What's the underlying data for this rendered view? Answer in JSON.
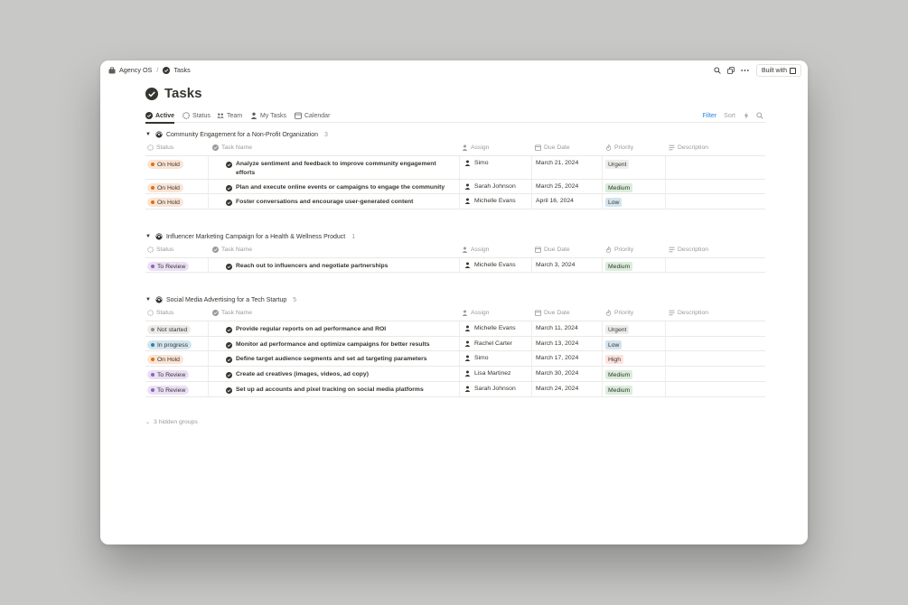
{
  "breadcrumb": {
    "workspace": "Agency OS",
    "separator": "/",
    "page": "Tasks"
  },
  "top_actions": {
    "built_label": "Built with"
  },
  "page": {
    "title": "Tasks"
  },
  "tabs": [
    {
      "label": "Active",
      "icon": "check-circle-icon",
      "active": true
    },
    {
      "label": "Status",
      "icon": "circle-icon",
      "active": false
    },
    {
      "label": "Team",
      "icon": "people-icon",
      "active": false
    },
    {
      "label": "My Tasks",
      "icon": "person-icon",
      "active": false
    },
    {
      "label": "Calendar",
      "icon": "calendar-icon",
      "active": false
    }
  ],
  "toolbar": {
    "filter": "Filter",
    "sort": "Sort"
  },
  "columns": {
    "status": "Status",
    "task": "Task Name",
    "assign": "Assign",
    "due": "Due Date",
    "priority": "Priority",
    "description": "Description"
  },
  "colors": {
    "onhold_bg": "#fbe4d5",
    "onhold_dot": "#d9730d",
    "review_bg": "#ebdff5",
    "review_dot": "#9065b0",
    "notstarted_bg": "#ecebea",
    "notstarted_dot": "#91918e",
    "inprogress_bg": "#d3e5ef",
    "inprogress_dot": "#337ea9",
    "urgent_bg": "#ededeb",
    "medium_bg": "#dbeddb",
    "low_bg": "#d3e5ef",
    "high_bg": "#ffe2dd",
    "filter": "#2383e2"
  },
  "groups": [
    {
      "name": "Community Engagement for a Non-Profit Organization",
      "count": "3",
      "rows": [
        {
          "status": "On Hold",
          "status_kind": "onhold",
          "task": "Analyze sentiment and feedback to improve community engagement efforts",
          "assign": "Simo",
          "due": "March 21, 2024",
          "priority": "Urgent",
          "priority_kind": "urgent"
        },
        {
          "status": "On Hold",
          "status_kind": "onhold",
          "task": "Plan and execute online events or campaigns to engage the community",
          "assign": "Sarah Johnson",
          "due": "March 25, 2024",
          "priority": "Medium",
          "priority_kind": "medium"
        },
        {
          "status": "On Hold",
          "status_kind": "onhold",
          "task": "Foster conversations and encourage user-generated content",
          "assign": "Michelle Evans",
          "due": "April 16, 2024",
          "priority": "Low",
          "priority_kind": "low"
        }
      ]
    },
    {
      "name": "Influencer Marketing Campaign for a Health & Wellness Product",
      "count": "1",
      "rows": [
        {
          "status": "To Review",
          "status_kind": "review",
          "task": "Reach out to influencers and negotiate partnerships",
          "assign": "Michelle Evans",
          "due": "March 3, 2024",
          "priority": "Medium",
          "priority_kind": "medium"
        }
      ]
    },
    {
      "name": "Social Media Advertising for a Tech Startup",
      "count": "5",
      "rows": [
        {
          "status": "Not started",
          "status_kind": "notstarted",
          "task": "Provide regular reports on ad performance and ROI",
          "assign": "Michelle Evans",
          "due": "March 11, 2024",
          "priority": "Urgent",
          "priority_kind": "urgent"
        },
        {
          "status": "In progress",
          "status_kind": "inprogress",
          "task": "Monitor ad performance and optimize campaigns for better results",
          "assign": "Rachel Carter",
          "due": "March 13, 2024",
          "priority": "Low",
          "priority_kind": "low"
        },
        {
          "status": "On Hold",
          "status_kind": "onhold",
          "task": "Define target audience segments and set ad targeting parameters",
          "assign": "Simo",
          "due": "March 17, 2024",
          "priority": "High",
          "priority_kind": "high"
        },
        {
          "status": "To Review",
          "status_kind": "review",
          "task": "Create ad creatives (images, videos, ad copy)",
          "assign": "Lisa Martinez",
          "due": "March 30, 2024",
          "priority": "Medium",
          "priority_kind": "medium"
        },
        {
          "status": "To Review",
          "status_kind": "review",
          "task": "Set up ad accounts and pixel tracking on social media platforms",
          "assign": "Sarah Johnson",
          "due": "March 24, 2024",
          "priority": "Medium",
          "priority_kind": "medium"
        }
      ]
    }
  ],
  "footer": {
    "hidden_groups": "3 hidden groups"
  }
}
